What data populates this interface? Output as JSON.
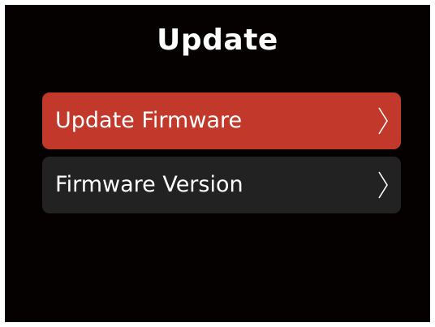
{
  "screen": {
    "title": "Update"
  },
  "menu": {
    "items": [
      {
        "label": "Update Firmware",
        "selected": true,
        "icon": "chevron-right-icon"
      },
      {
        "label": "Firmware Version",
        "selected": false,
        "icon": "chevron-right-icon"
      }
    ]
  },
  "colors": {
    "background": "#050101",
    "selected_item": "#c2392b",
    "item": "#222222",
    "text": "#ffffff"
  }
}
